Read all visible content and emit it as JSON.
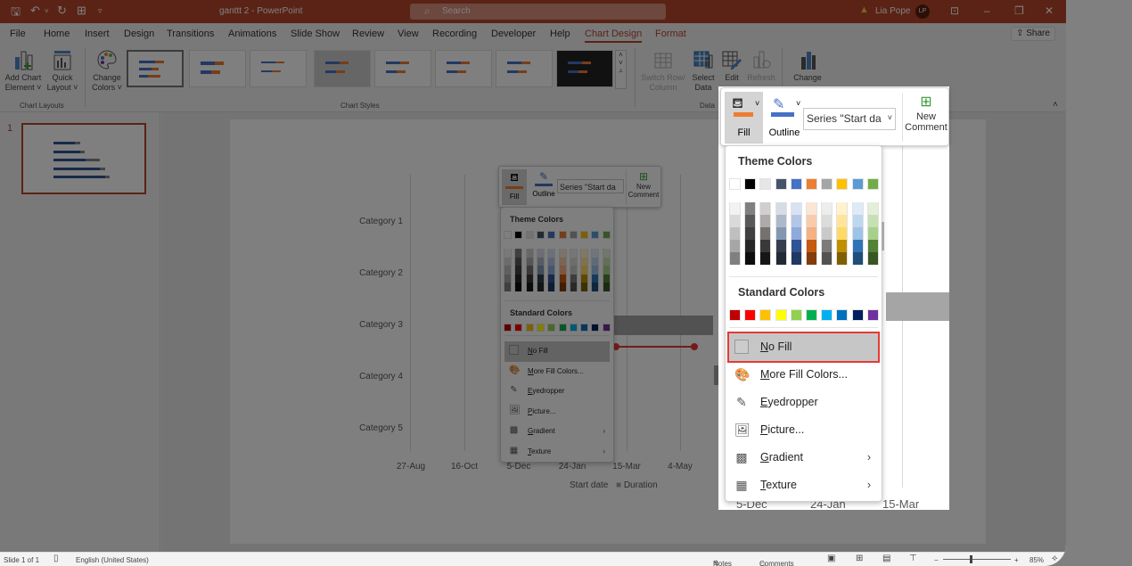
{
  "window": {
    "title": "ganttt 2  -  PowerPoint",
    "search_placeholder": "Search",
    "user_name": "Lia Pope",
    "user_initials": "LP",
    "accent": "#b7472a"
  },
  "menu_tabs": [
    "File",
    "Home",
    "Insert",
    "Design",
    "Transitions",
    "Animations",
    "Slide Show",
    "Review",
    "View",
    "Recording",
    "Developer",
    "Help",
    "Chart Design",
    "Format"
  ],
  "active_tab": "Chart Design",
  "share_label": "Share",
  "ribbon": {
    "add_chart_element": [
      "Add Chart",
      "Element ˅"
    ],
    "quick_layout": [
      "Quick",
      "Layout ˅"
    ],
    "change_colors": [
      "Change",
      "Colors ˅"
    ],
    "chart_layouts_label": "Chart Layouts",
    "chart_styles_label": "Chart Styles",
    "switch_row_col": [
      "Switch Row/",
      "Column"
    ],
    "select_data": [
      "Select",
      "Data"
    ],
    "edit_data": [
      "Edit",
      ""
    ],
    "refresh_data": [
      "Refresh",
      ""
    ],
    "data_label": "Data",
    "change_chart_type": [
      "Change",
      ""
    ]
  },
  "slides_panel": {
    "slide_number": "1"
  },
  "chart": {
    "categories": [
      "Category 1",
      "Category 2",
      "Category 3",
      "Category 4",
      "Category 5"
    ],
    "x_ticks": [
      "27-Aug",
      "16-Oct",
      "5-Dec",
      "24-Jan",
      "15-Mar",
      "4-May"
    ],
    "legend": [
      "Start date",
      "Duration"
    ]
  },
  "mini_toolbar": {
    "fill_label": "Fill",
    "outline_label": "Outline",
    "series_select": "Series \"Start da",
    "new_comment": [
      "New",
      "Comment"
    ]
  },
  "fill_menu": {
    "theme_colors_label": "Theme Colors",
    "theme_base": [
      "#ffffff",
      "#000000",
      "#e7e6e6",
      "#44546a",
      "#4472c4",
      "#ed7d31",
      "#a5a5a5",
      "#ffc000",
      "#5b9bd5",
      "#70ad47"
    ],
    "theme_shades": [
      [
        "#f2f2f2",
        "#d9d9d9",
        "#bfbfbf",
        "#a6a6a6",
        "#808080"
      ],
      [
        "#808080",
        "#595959",
        "#404040",
        "#262626",
        "#0d0d0d"
      ],
      [
        "#d0cece",
        "#aeaaaa",
        "#757171",
        "#3a3838",
        "#171616"
      ],
      [
        "#d6dce4",
        "#adb9ca",
        "#8497b0",
        "#333f4f",
        "#222a35"
      ],
      [
        "#d9e2f3",
        "#b4c6e7",
        "#8eaadb",
        "#2f5496",
        "#1f3864"
      ],
      [
        "#fbe5d5",
        "#f7cbac",
        "#f4b183",
        "#c55a11",
        "#843c0b"
      ],
      [
        "#ededed",
        "#dbdbdb",
        "#c9c9c9",
        "#7b7b7b",
        "#525252"
      ],
      [
        "#fff2cc",
        "#fee599",
        "#ffd965",
        "#bf9000",
        "#7f6000"
      ],
      [
        "#deeaf6",
        "#bdd7ee",
        "#9dc3e6",
        "#2e75b5",
        "#1e4e79"
      ],
      [
        "#e2efd9",
        "#c5e0b3",
        "#a8d08d",
        "#538135",
        "#375623"
      ]
    ],
    "standard_colors_label": "Standard Colors",
    "standard_colors": [
      "#c00000",
      "#ff0000",
      "#ffc000",
      "#ffff00",
      "#92d050",
      "#00b050",
      "#00b0f0",
      "#0070c0",
      "#002060",
      "#7030a0"
    ],
    "items": [
      {
        "name": "no-fill",
        "accel": "N",
        "rest": "o Fill",
        "highlighted": true
      },
      {
        "name": "more-fill-colors",
        "accel": "M",
        "rest": "ore Fill Colors...",
        "highlighted": false
      },
      {
        "name": "eyedropper",
        "accel": "E",
        "rest": "yedropper",
        "highlighted": false
      },
      {
        "name": "picture",
        "accel": "P",
        "rest": "icture...",
        "highlighted": false
      },
      {
        "name": "gradient",
        "accel": "G",
        "rest": "radient",
        "highlighted": false,
        "submenu": true
      },
      {
        "name": "texture",
        "accel": "T",
        "rest": "exture",
        "highlighted": false,
        "submenu": true
      }
    ],
    "highlight_color": "#e53935"
  },
  "zoomed_axis_ticks": [
    "5-Dec",
    "24-Jan",
    "15-Mar"
  ],
  "status_bar": {
    "slide_info": "Slide 1 of 1",
    "language": "English (United States)",
    "notes": "Notes",
    "comments": "Comments",
    "zoom_level": "85%"
  }
}
